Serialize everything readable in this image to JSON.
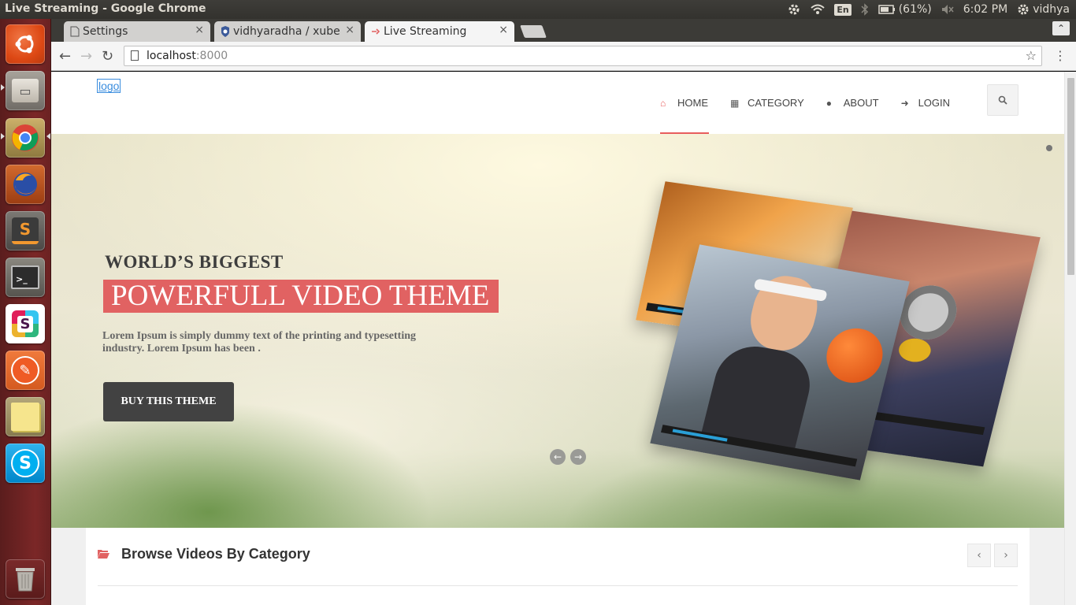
{
  "os": {
    "window_title": "Live Streaming - Google Chrome",
    "language": "En",
    "battery": "(61%)",
    "clock": "6:02 PM",
    "user": "vidhya"
  },
  "launcher": {
    "items": [
      "ubuntu-dash",
      "files",
      "google-chrome",
      "firefox",
      "sublime-text",
      "terminal",
      "slack",
      "postman",
      "sticky-notes",
      "skype",
      "trash"
    ],
    "glyphs": {
      "files": "▭",
      "sublime": "S",
      "terminal": ">_",
      "slack": "S",
      "postman": "✎",
      "skype": "S"
    }
  },
  "browser": {
    "tabs": [
      {
        "title": "Settings",
        "icon": "page-icon"
      },
      {
        "title": "vidhyaradha / xube",
        "icon": "repo-icon"
      },
      {
        "title": "Live Streaming",
        "icon": "favicon"
      }
    ],
    "close_glyph": "×",
    "minimize_glyph": "⌃",
    "url_host": "localhost",
    "url_port": ":8000",
    "back_glyph": "←",
    "forward_glyph": "→",
    "reload_glyph": "↻",
    "star_glyph": "☆",
    "menu_glyph": "⋮"
  },
  "site": {
    "logo": "logo",
    "nav": [
      {
        "label": "HOME",
        "icon": "home-icon",
        "glyph": "⌂",
        "active": true
      },
      {
        "label": "CATEGORY",
        "icon": "film-icon",
        "glyph": "▦",
        "active": false
      },
      {
        "label": "ABOUT",
        "icon": "user-icon",
        "glyph": "●",
        "active": false
      },
      {
        "label": "LOGIN",
        "icon": "sign-in-icon",
        "glyph": "➜",
        "active": false
      }
    ],
    "accent": "#e16262"
  },
  "hero": {
    "eyebrow": "WORLD’S BIGGEST",
    "title": "POWERFULL VIDEO THEME",
    "description": "Lorem Ipsum is simply dummy text of the printing and typesetting industry. Lorem Ipsum has been .",
    "button": "BUY THIS THEME",
    "prev_glyph": "←",
    "next_glyph": "→"
  },
  "browse": {
    "title": "Browse Videos By Category",
    "prev_glyph": "‹",
    "next_glyph": "›"
  }
}
